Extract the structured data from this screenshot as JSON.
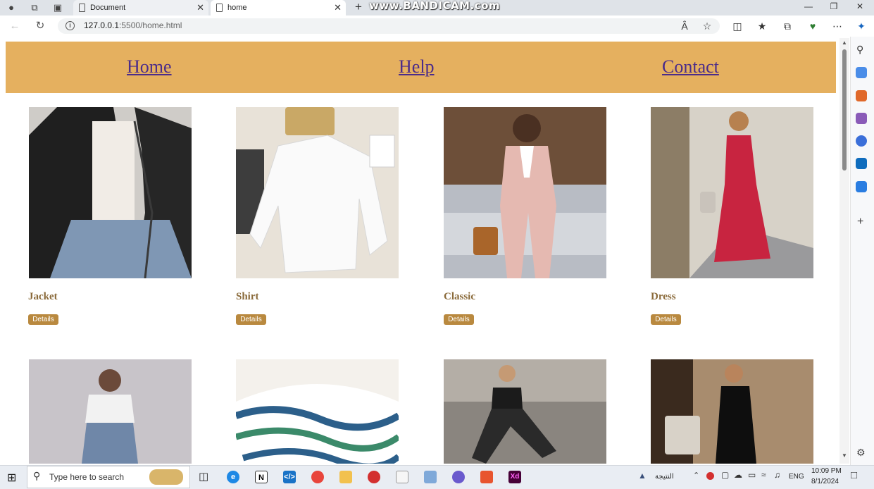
{
  "browser": {
    "tabs": [
      {
        "title": "Document",
        "active": false
      },
      {
        "title": "home",
        "active": true
      }
    ],
    "recording_watermark": "www.BANDICAM.com",
    "url_host": "127.0.0.1",
    "url_path": ":5500/home.html"
  },
  "navbar": {
    "links": [
      "Home",
      "Help",
      "Contact"
    ],
    "background": "#e5b05f",
    "link_color": "#4b2c8a"
  },
  "products": [
    {
      "name": "Jacket",
      "button": "Details"
    },
    {
      "name": "Shirt",
      "button": "Details"
    },
    {
      "name": "Classic",
      "button": "Details"
    },
    {
      "name": "Dress",
      "button": "Details"
    }
  ],
  "second_row_images": [
    "white-top-jeans-photo",
    "striped-blouse-photo",
    "sportswear-photo",
    "black-dress-photo"
  ],
  "taskbar": {
    "search_placeholder": "Type here to search",
    "weather_label": "النتيجة",
    "language": "ENG",
    "time": "10:09 PM",
    "date": "8/1/2024"
  },
  "colors": {
    "button_bg": "#b9893f",
    "product_name": "#8a6a3a"
  }
}
